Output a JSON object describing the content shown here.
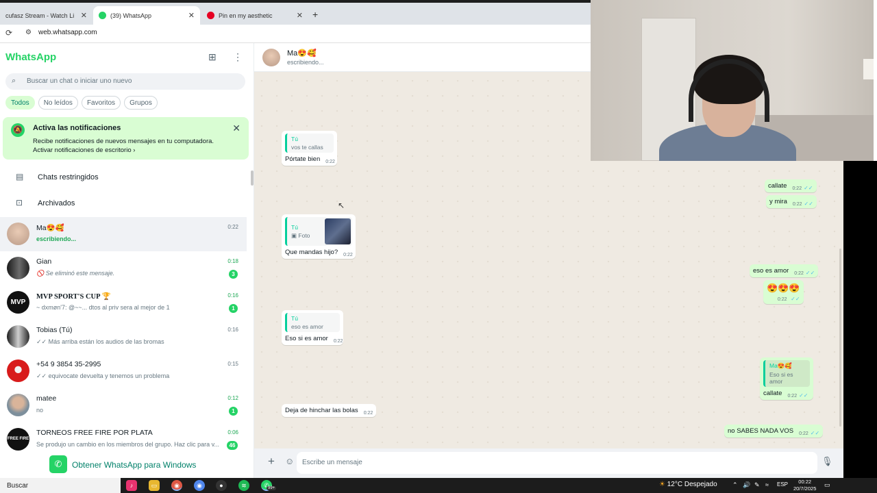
{
  "browser": {
    "tabs": [
      {
        "label": "cufasz Stream - Watch Live on",
        "active": false
      },
      {
        "label": "(39) WhatsApp",
        "active": true
      },
      {
        "label": "Pin en my aesthetic",
        "active": false
      }
    ],
    "url": "web.whatsapp.com"
  },
  "sidebar": {
    "title": "WhatsApp",
    "search_placeholder": "Buscar un chat o iniciar uno nuevo",
    "filters": [
      "Todos",
      "No leídos",
      "Favoritos",
      "Grupos"
    ],
    "notification": {
      "title": "Activa las notificaciones",
      "text": "Recibe notificaciones de nuevos mensajes en tu computadora.",
      "link": "Activar notificaciones de escritorio ›"
    },
    "restricted_label": "Chats restringidos",
    "archived_label": "Archivados",
    "chats": [
      {
        "name": "Ma😍🥰",
        "preview": "escribiendo...",
        "time": "0:22",
        "unread": ""
      },
      {
        "name": "Gian",
        "preview": "🚫 Se eliminó este mensaje.",
        "time": "0:18",
        "unread": "3"
      },
      {
        "name": "MVP  SPORT'S CUP  🏆",
        "preview": "~ dxmøn'7: @~~... dtos al priv sera al mejor de 1",
        "time": "0:16",
        "unread": "1"
      },
      {
        "name": "Tobias (Tú)",
        "preview": "✓✓ Más arriba están los audios de las bromas",
        "time": "0:16",
        "unread": ""
      },
      {
        "name": "+54 9 3854 35-2995",
        "preview": "✓✓ equivocate devuelta y tenemos un problema",
        "time": "0:15",
        "unread": ""
      },
      {
        "name": "matee",
        "preview": "no",
        "time": "0:12",
        "unread": "1"
      },
      {
        "name": "TORNEOS FREE FIRE POR PLATA",
        "preview": "Se produjo un cambio en los miembros del grupo. Haz clic para v...",
        "time": "0:06",
        "unread": "46"
      }
    ],
    "get_app_label": "Obtener WhatsApp para Windows"
  },
  "conversation": {
    "contact_name": "Ma😍🥰",
    "status": "escribiendo...",
    "messages": [
      {
        "dir": "in",
        "quote_author": "Tú",
        "quote_text": "vos te callas",
        "text": "Pórtate bien",
        "time": "0:22"
      },
      {
        "dir": "out",
        "text": "callate",
        "time": "0:22"
      },
      {
        "dir": "out",
        "text": "y mira",
        "time": "0:22"
      },
      {
        "dir": "in",
        "quote_author": "Tú",
        "quote_text": "Foto",
        "text": "Que mandas hijo?",
        "time": "0:22"
      },
      {
        "dir": "out",
        "text": "eso es amor",
        "time": "0:22"
      },
      {
        "dir": "out",
        "text": "😍😍😍",
        "time": "0:22"
      },
      {
        "dir": "in",
        "quote_author": "Tú",
        "quote_text": "eso es amor",
        "text": "Eso si es amor",
        "time": "0:22"
      },
      {
        "dir": "out",
        "quote_author": "Ma😍🥰",
        "quote_text": "Eso si es amor",
        "text": "callate",
        "time": "0:22"
      },
      {
        "dir": "in",
        "text": "Deja de hinchar las bolas",
        "time": "0:22"
      },
      {
        "dir": "out",
        "text": "no SABES NADA VOS",
        "time": "0:22"
      }
    ],
    "composer_placeholder": "Escribe un mensaje"
  },
  "taskbar": {
    "search_label": "Buscar",
    "badge": "99+",
    "weather": "12°C  Despejado",
    "lang": "ESP",
    "time": "00:22",
    "date": "20/7/2025"
  },
  "colors": {
    "accent": "#25d366",
    "outgoing_bubble": "#d9fdd3",
    "chat_background": "#efeae2",
    "read_ticks": "#53bdeb"
  }
}
